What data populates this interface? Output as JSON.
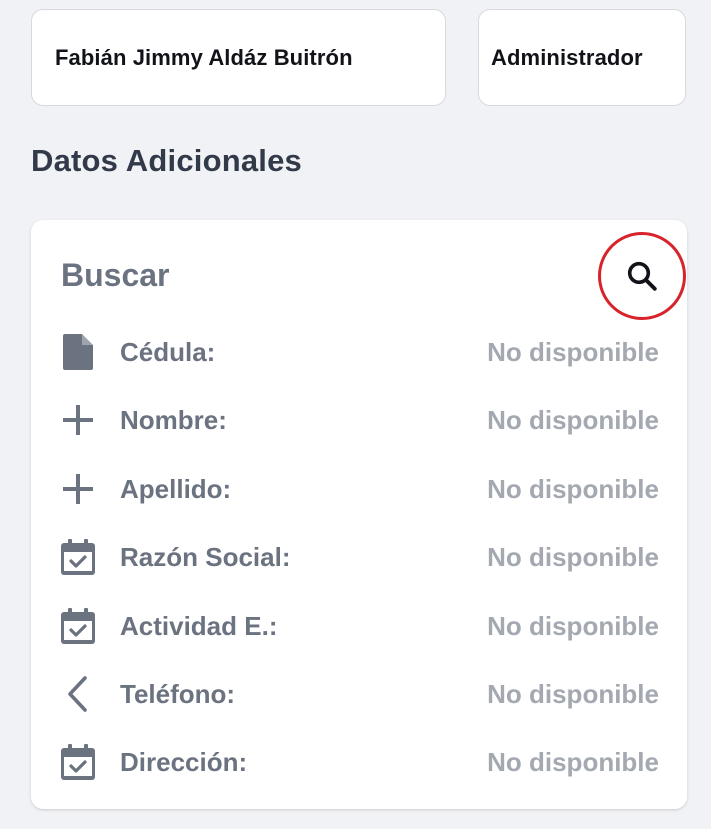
{
  "user": {
    "full_name": "Fabián Jimmy Aldáz Buitrón",
    "role": "Administrador"
  },
  "section": {
    "title": "Datos Adicionales"
  },
  "card": {
    "title": "Buscar",
    "search_icon": "search-icon",
    "highlight_color": "#d8232a",
    "rows": [
      {
        "icon": "document-icon",
        "label": "Cédula:",
        "value": "No disponible"
      },
      {
        "icon": "plus-icon",
        "label": "Nombre:",
        "value": "No disponible"
      },
      {
        "icon": "plus-icon",
        "label": "Apellido:",
        "value": "No disponible"
      },
      {
        "icon": "calendar-check-icon",
        "label": "Razón Social:",
        "value": "No disponible"
      },
      {
        "icon": "calendar-check-icon",
        "label": "Actividad E.:",
        "value": "No disponible"
      },
      {
        "icon": "chevron-left-icon",
        "label": "Teléfono:",
        "value": "No disponible"
      },
      {
        "icon": "calendar-check-icon",
        "label": "Dirección:",
        "value": "No disponible"
      }
    ]
  }
}
